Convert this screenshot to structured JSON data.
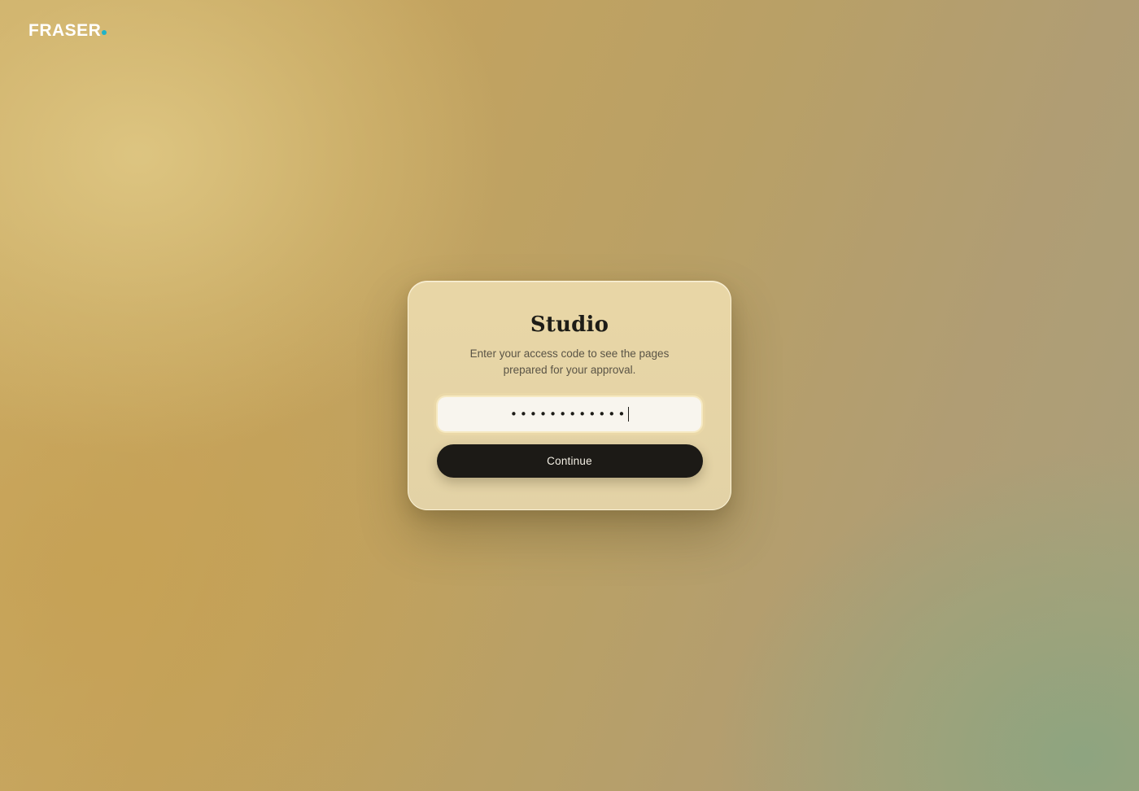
{
  "brand": {
    "name": "FRASER",
    "dot_color": "#1fb3c8"
  },
  "login": {
    "title": "Studio",
    "subtitle": "Enter your access code to see the pages prepared for your approval.",
    "code_masked": "••••••••••••",
    "continue_label": "Continue"
  },
  "colors": {
    "button_bg": "#1c1a16",
    "card_bg": "#e8d6a8"
  }
}
